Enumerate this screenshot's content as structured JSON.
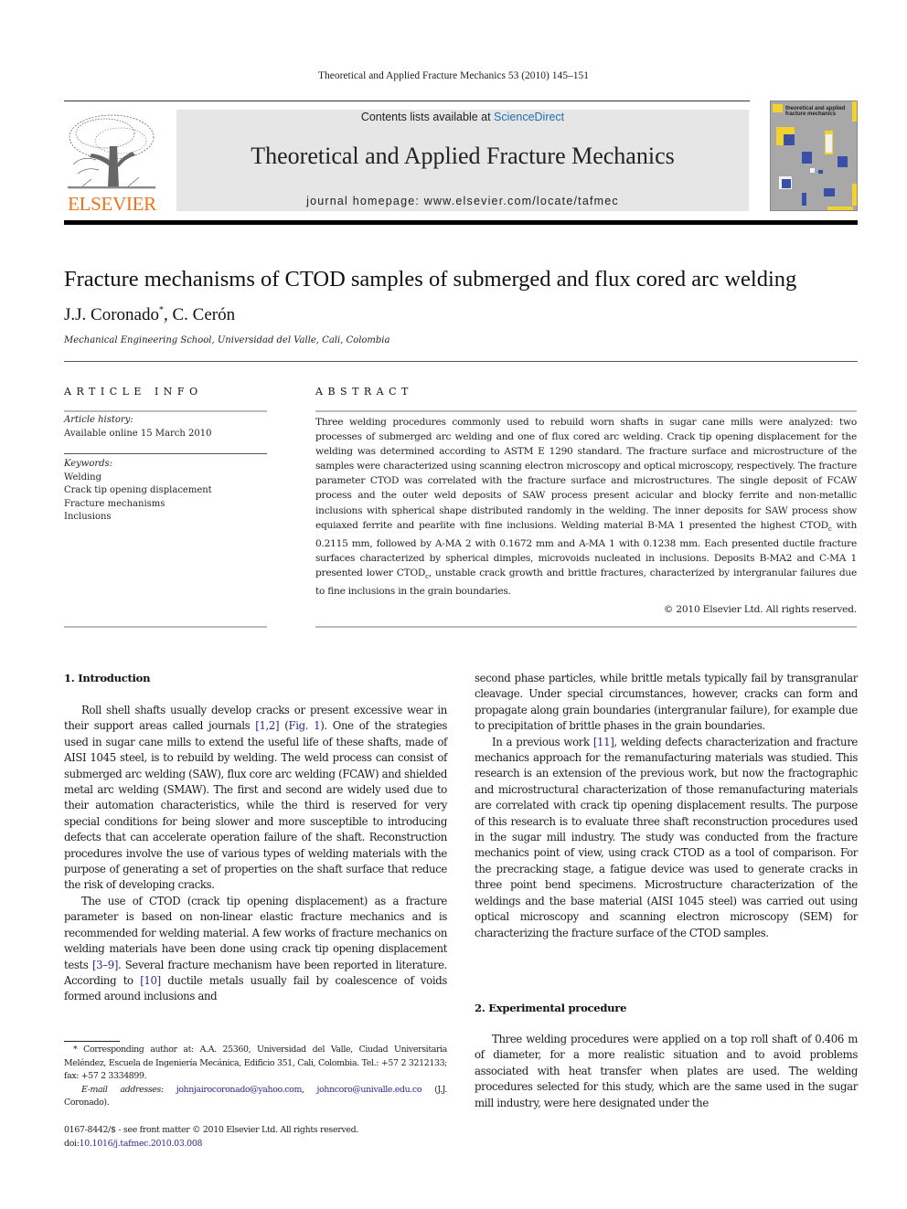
{
  "running_head": "Theoretical and Applied Fracture Mechanics 53 (2010) 145–151",
  "masthead": {
    "publisher_logo": "ELSEVIER",
    "contents_prefix": "Contents lists available at ",
    "contents_link": "ScienceDirect",
    "journal_title": "Theoretical and Applied Fracture Mechanics",
    "homepage": "journal homepage: www.elsevier.com/locate/tafmec",
    "cover_title_line1": "theoretical and applied",
    "cover_title_line2": "fracture mechanics"
  },
  "article": {
    "title": "Fracture mechanisms of CTOD samples of submerged and flux cored arc welding",
    "author1": "J.J. Coronado",
    "author1_mark": "*",
    "author_sep": ", ",
    "author2": "C. Cerón",
    "affiliation": "Mechanical Engineering School, Universidad del Valle, Cali, Colombia"
  },
  "article_info": {
    "heading": "ARTICLE INFO",
    "history_label": "Article history:",
    "history_value": "Available online 15 March 2010",
    "keywords_label": "Keywords:",
    "keywords": [
      "Welding",
      "Crack tip opening displacement",
      "Fracture mechanisms",
      "Inclusions"
    ]
  },
  "abstract": {
    "heading": "ABSTRACT",
    "part1": "Three welding procedures commonly used to rebuild worn shafts in sugar cane mills were analyzed: two processes of submerged arc welding and one of flux cored arc welding. Crack tip opening displacement for the welding was determined according to ASTM E 1290 standard. The fracture surface and microstructure of the samples were characterized using scanning electron microscopy and optical microscopy, respectively. The fracture parameter CTOD was correlated with the fracture surface and microstructures. The single deposit of FCAW process and the outer weld deposits of SAW process present acicular and blocky ferrite and non-metallic inclusions with spherical shape distributed randomly in the welding. The inner deposits for SAW process show equiaxed ferrite and pearlite with fine inclusions. Welding material B-MA 1 presented the highest CTOD",
    "sub": "c",
    "part2": " with 0.2115 mm, followed by A-MA 2 with 0.1672 mm and A-MA 1 with 0.1238 mm. Each presented ductile fracture surfaces characterized by spherical dimples, microvoids nucleated in inclusions. Deposits B-MA2 and C-MA 1 presented lower CTOD",
    "part3": ", unstable crack growth and brittle fractures, characterized by intergranular failures due to fine inclusions in the grain boundaries.",
    "copyright": "© 2010 Elsevier Ltd. All rights reserved."
  },
  "body": {
    "sec1_heading": "1. Introduction",
    "p1_a": "Roll shell shafts usually develop cracks or present excessive wear in their support areas called journals ",
    "p1_ref1": "[1,2]",
    "p1_b": " (",
    "p1_fig": "Fig. 1",
    "p1_c": "). One of the strategies used in sugar cane mills to extend the useful life of these shafts, made of AISI 1045 steel, is to rebuild by welding. The weld process can consist of submerged arc welding (SAW), flux core arc welding (FCAW) and shielded metal arc welding (SMAW). The first and second are widely used due to their automation characteristics, while the third is reserved for very special conditions for being slower and more susceptible to introducing defects that can accelerate operation failure of the shaft. Reconstruction procedures involve the use of various types of welding materials with the purpose of generating a set of properties on the shaft surface that reduce the risk of developing cracks.",
    "p2_a": "The use of CTOD (crack tip opening displacement) as a fracture parameter is based on non-linear elastic fracture mechanics and is recommended for welding material. A few works of fracture mechanics on welding materials have been done using crack tip opening displacement tests ",
    "p2_ref1": "[3–9]",
    "p2_b": ". Several fracture mechanism have been reported in literature. According to ",
    "p2_ref2": "[10]",
    "p2_c": " ductile metals usually fail by coalescence of voids formed around inclusions and",
    "p2_cont": "second phase particles, while brittle metals typically fail by transgranular cleavage. Under special circumstances, however, cracks can form and propagate along grain boundaries (intergranular failure), for example due to precipitation of brittle phases in the grain boundaries.",
    "p3_a": "In a previous work ",
    "p3_ref": "[11]",
    "p3_b": ", welding defects characterization and fracture mechanics approach for the remanufacturing materials was studied. This research is an extension of the previous work, but now the fractographic and microstructural characterization of those remanufacturing materials are correlated with crack tip opening displacement results. The purpose of this research is to evaluate three shaft reconstruction procedures used in the sugar mill industry. The study was conducted from the fracture mechanics point of view, using crack CTOD as a tool of comparison. For the precracking stage, a fatigue device was used to generate cracks in three point bend specimens. Microstructure characterization of the weldings and the base material (AISI 1045 steel) was carried out using optical microscopy and scanning electron microscopy (SEM) for characterizing the fracture surface of the CTOD samples.",
    "sec2_heading": "2. Experimental procedure",
    "p4": "Three welding procedures were applied on a top roll shaft of 0.406 m of diameter, for a more realistic situation and to avoid problems associated with heat transfer when plates are used. The welding procedures selected for this study, which are the same used in the sugar mill industry, were here designated under the"
  },
  "footnote": {
    "mark": "*",
    "text": " Corresponding author at: A.A. 25360, Universidad del Valle, Ciudad Universitaria Meléndez, Escuela de Ingeniería Mecánica, Edificio 351, Cali, Colombia. Tel.: +57 2 3212133; fax: +57 2 3334899.",
    "email_label": "E-mail addresses:",
    "email1": "johnjairocoronado@yahoo.com",
    "email_sep": ", ",
    "email2": "johncoro@univalle.edu.co",
    "email_owner": "(J.J. Coronado)."
  },
  "front_matter": {
    "issn_line": "0167-8442/$ - see front matter © 2010 Elsevier Ltd. All rights reserved.",
    "doi_prefix": "doi:",
    "doi": "10.1016/j.tafmec.2010.03.008"
  },
  "colors": {
    "link": "#2a2a8a",
    "sciencedirect": "#1f6fb2",
    "elsevier_orange": "#e8741c",
    "masthead_bg": "#e6e6e6"
  }
}
